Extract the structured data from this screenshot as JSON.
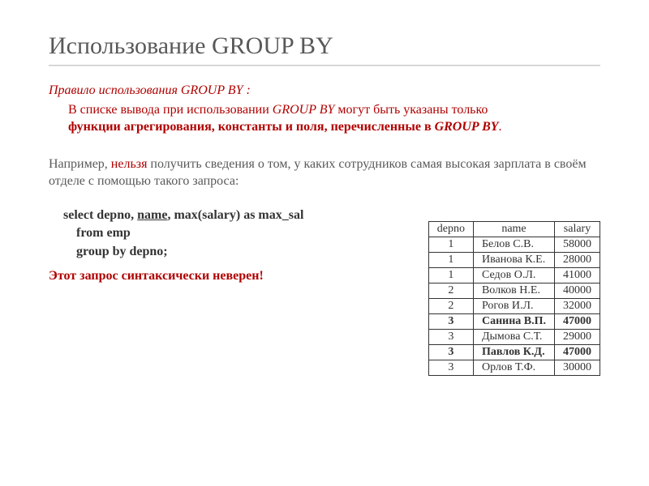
{
  "title": "Использование GROUP BY",
  "rule": {
    "label": "Правило использования GROUP BY :",
    "line1_pre": "В списке вывода при использовании ",
    "line1_gb": "GROUP BY",
    "line1_post": " могут быть указаны только",
    "line2_pre": "функции агрегирования, константы и поля, перечисленные в ",
    "line2_gb": "GROUP BY",
    "line2_post": "."
  },
  "para": {
    "pre": "Например, ",
    "nel": "нельзя",
    "post": " получить сведения о том, у каких сотрудников самая высокая зарплата в своём отделе с помощью такого запроса:"
  },
  "code": {
    "l1a": "select  depno,  ",
    "l1b": "name",
    "l1c": ",  max(salary) as max_sal",
    "l2": "from  emp",
    "l3": "group by  depno;"
  },
  "error_note": "Этот запрос синтаксически неверен!",
  "table": {
    "headers": [
      "depno",
      "name",
      "salary"
    ],
    "rows": [
      {
        "depno": "1",
        "name": "Белов С.В.",
        "salary": "58000",
        "bold": false
      },
      {
        "depno": "1",
        "name": "Иванова К.Е.",
        "salary": "28000",
        "bold": false
      },
      {
        "depno": "1",
        "name": "Седов О.Л.",
        "salary": "41000",
        "bold": false
      },
      {
        "depno": "2",
        "name": "Волков Н.Е.",
        "salary": "40000",
        "bold": false
      },
      {
        "depno": "2",
        "name": "Рогов И.Л.",
        "salary": "32000",
        "bold": false
      },
      {
        "depno": "3",
        "name": "Санина В.П.",
        "salary": "47000",
        "bold": true
      },
      {
        "depno": "3",
        "name": "Дымова С.Т.",
        "salary": "29000",
        "bold": false
      },
      {
        "depno": "3",
        "name": "Павлов К.Д.",
        "salary": "47000",
        "bold": true
      },
      {
        "depno": "3",
        "name": "Орлов Т.Ф.",
        "salary": "30000",
        "bold": false
      }
    ]
  },
  "chart_data": {
    "type": "table",
    "title": "emp",
    "columns": [
      "depno",
      "name",
      "salary"
    ],
    "rows": [
      [
        1,
        "Белов С.В.",
        58000
      ],
      [
        1,
        "Иванова К.Е.",
        28000
      ],
      [
        1,
        "Седов О.Л.",
        41000
      ],
      [
        2,
        "Волков Н.Е.",
        40000
      ],
      [
        2,
        "Рогов И.Л.",
        32000
      ],
      [
        3,
        "Санина В.П.",
        47000
      ],
      [
        3,
        "Дымова С.Т.",
        29000
      ],
      [
        3,
        "Павлов К.Д.",
        47000
      ],
      [
        3,
        "Орлов Т.Ф.",
        30000
      ]
    ]
  }
}
